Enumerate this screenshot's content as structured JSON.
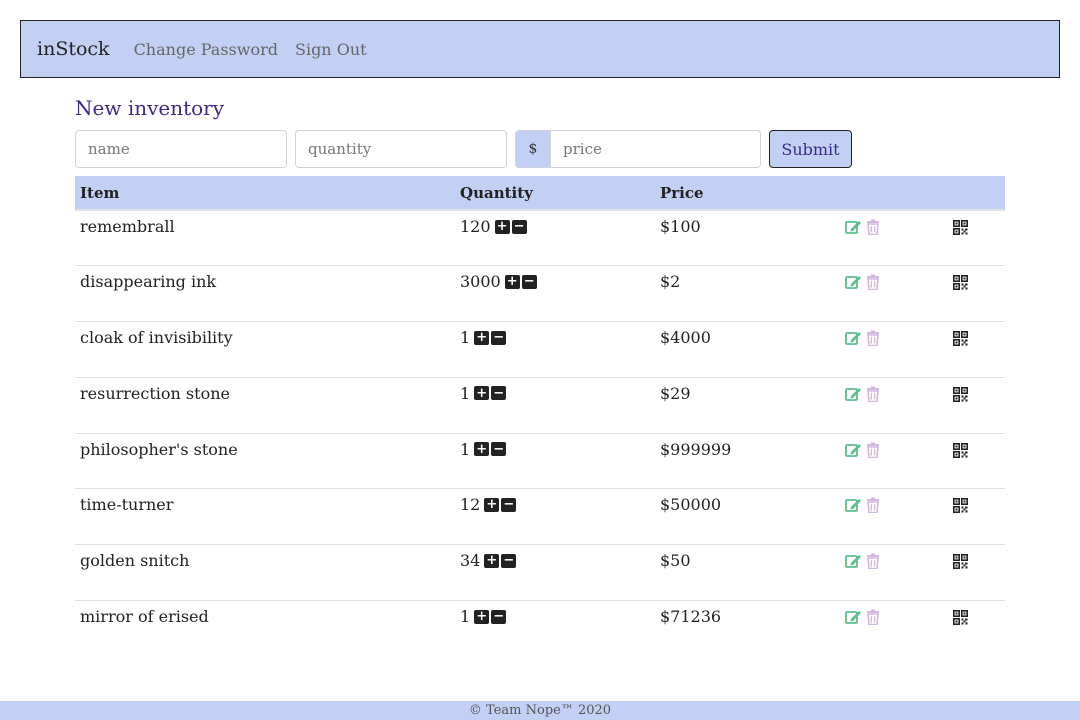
{
  "navbar": {
    "brand": "inStock",
    "links": [
      "Change Password",
      "Sign Out"
    ]
  },
  "form": {
    "title": "New inventory",
    "name_placeholder": "name",
    "quantity_placeholder": "quantity",
    "currency_symbol": "$",
    "price_placeholder": "price",
    "submit_label": "Submit"
  },
  "table": {
    "headers": [
      "Item",
      "Quantity",
      "Price"
    ],
    "rows": [
      {
        "item": "remembrall",
        "quantity": "120",
        "price": "$100"
      },
      {
        "item": "disappearing ink",
        "quantity": "3000",
        "price": "$2"
      },
      {
        "item": "cloak of invisibility",
        "quantity": "1",
        "price": "$4000"
      },
      {
        "item": "resurrection stone",
        "quantity": "1",
        "price": "$29"
      },
      {
        "item": "philosopher's stone",
        "quantity": "1",
        "price": "$999999"
      },
      {
        "item": "time-turner",
        "quantity": "12",
        "price": "$50000"
      },
      {
        "item": "golden snitch",
        "quantity": "34",
        "price": "$50"
      },
      {
        "item": "mirror of erised",
        "quantity": "1",
        "price": "$71236"
      }
    ],
    "row_icons": {
      "increment": "plus-square-icon",
      "decrement": "minus-square-icon",
      "edit": "edit-icon",
      "delete": "trash-icon",
      "qr": "qr-code-icon"
    }
  },
  "footer": {
    "text": "© Team Nope™ 2020"
  },
  "colors": {
    "accent": "#c1d0f3",
    "title": "#3b2a8c",
    "edit": "#5bc08a",
    "delete": "#d3b8de"
  }
}
